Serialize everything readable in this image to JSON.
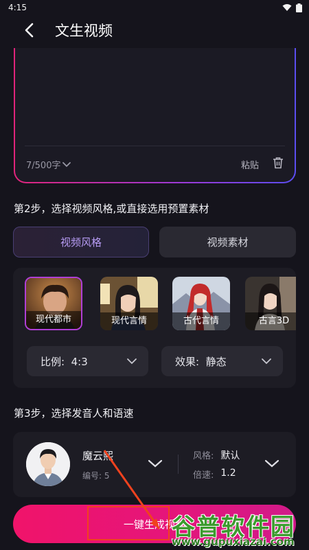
{
  "status_bar": {
    "time": "4:15"
  },
  "header": {
    "title": "文生视频"
  },
  "prompt": {
    "counter": "7/500字",
    "paste_label": "粘贴"
  },
  "step2": {
    "title": "第2步，选择视频风格,或直接选用预置素材",
    "tabs": [
      {
        "label": "视频风格",
        "active": true
      },
      {
        "label": "视频素材",
        "active": false
      }
    ],
    "styles": [
      {
        "label": "现代都市",
        "selected": true
      },
      {
        "label": "现代言情",
        "selected": false
      },
      {
        "label": "古代言情",
        "selected": false
      },
      {
        "label": "古言3D",
        "selected": false
      }
    ],
    "ratio": {
      "key": "比例:",
      "value": "4:3"
    },
    "effect": {
      "key": "效果:",
      "value": "静态"
    }
  },
  "step3": {
    "title": "第3步，选择发音人和语速",
    "voice": {
      "name": "魔云熙",
      "id_label": "编号: 5",
      "style_key": "风格:",
      "style_value": "默认",
      "speed_key": "倍速:",
      "speed_value": "1.2"
    }
  },
  "generate_button": {
    "label": "一键生成视频"
  },
  "watermark": {
    "main": "谷普软件园",
    "sub": "www.gupuxiazai.com"
  },
  "colors": {
    "accent_pink": "#e5157a",
    "accent_purple": "#b79cf4",
    "annotation_red": "#f0421e"
  }
}
